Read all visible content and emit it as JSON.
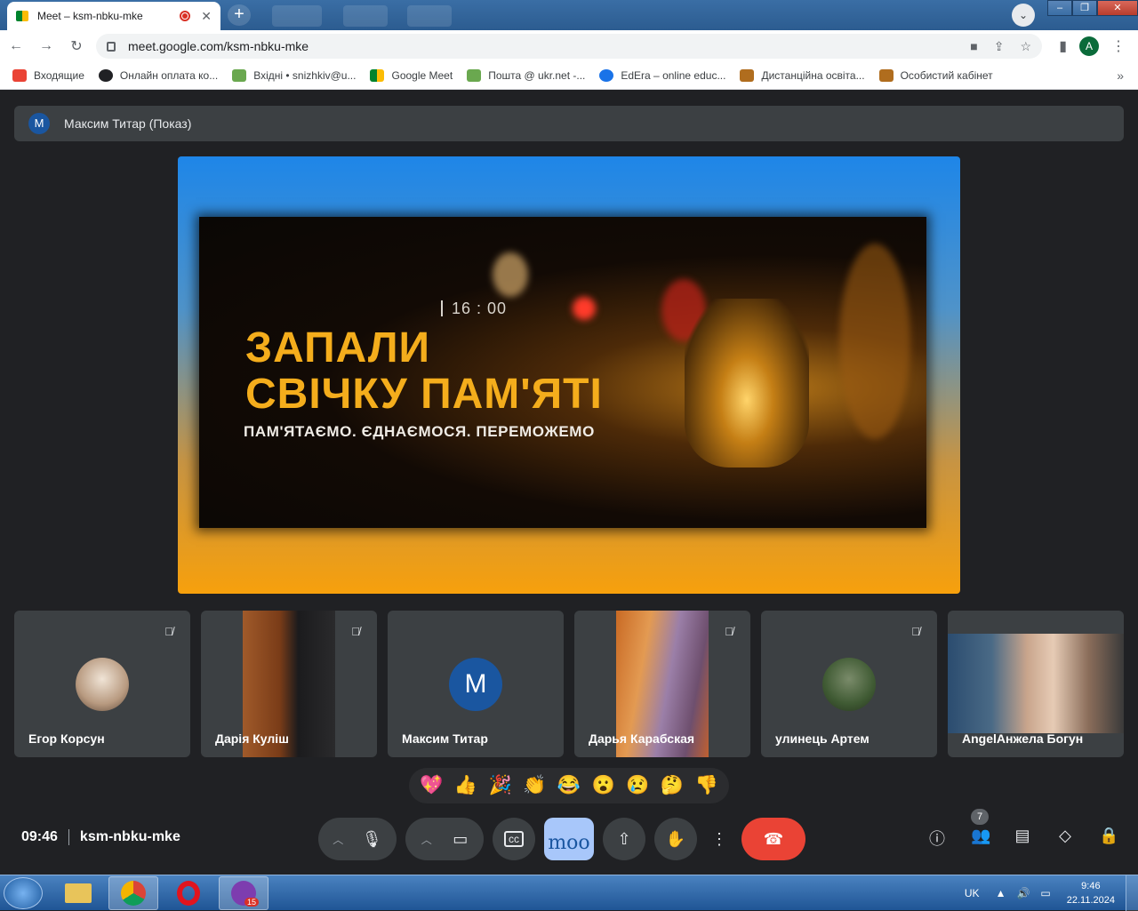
{
  "browser": {
    "tab_title": "Meet – ksm-nbku-mke",
    "new_tab": "+",
    "url": "meet.google.com/ksm-nbku-mke",
    "profile_initial": "A",
    "bookmarks": [
      {
        "label": "Входящие",
        "color": "#ea4335"
      },
      {
        "label": "Онлайн оплата ко...",
        "color": "#202124"
      },
      {
        "label": "Вхідні • snizhkiv@u...",
        "color": "#6aa84f"
      },
      {
        "label": "Google Meet",
        "color": "#00832d"
      },
      {
        "label": "Пошта @ ukr.net -...",
        "color": "#6aa84f"
      },
      {
        "label": "EdEra – online educ...",
        "color": "#1a73e8"
      },
      {
        "label": "Дистанційна освіта...",
        "color": "#b06d1e"
      },
      {
        "label": "Особистий кабінет",
        "color": "#b06d1e"
      }
    ]
  },
  "meet": {
    "presenter_initial": "M",
    "presenter_label": "Максим Титар (Показ)",
    "poster": {
      "time": "16 : 00",
      "title_line1": "ЗАПАЛИ",
      "title_line2": "СВІЧКУ ПАМ'ЯТІ",
      "subtitle": "ПАМ'ЯТАЄМО. ЄДНАЄМОСЯ. ПЕРЕМОЖЕМО"
    },
    "participants": [
      {
        "name": "Егор Корсун",
        "muted": true
      },
      {
        "name": "Дарія Куліш",
        "muted": true
      },
      {
        "name": "Максим Титар",
        "muted": false,
        "initial": "M"
      },
      {
        "name": "Дарья Карабская",
        "muted": true
      },
      {
        "name": "улинець Артем",
        "muted": true
      },
      {
        "name": "AngelАнжела Богун",
        "muted": false
      }
    ],
    "reactions": [
      "💖",
      "👍",
      "🎉",
      "👏",
      "😂",
      "😮",
      "😢",
      "🤔",
      "👎"
    ],
    "time": "09:46",
    "meeting_code": "ksm-nbku-mke",
    "mood_label": "moo",
    "participant_count": "7"
  },
  "taskbar": {
    "viber_badge": "15",
    "lang": "UK",
    "time": "9:46",
    "date": "22.11.2024"
  }
}
